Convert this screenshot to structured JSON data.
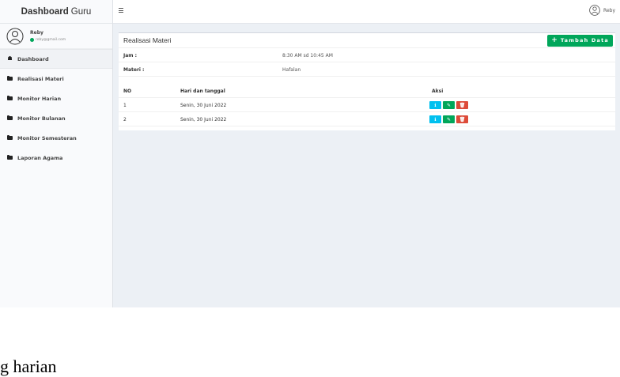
{
  "app": {
    "brand_bold": "Dashboard",
    "brand_light": "Guru"
  },
  "user": {
    "name": "Reby",
    "email": "reby@gmail.com",
    "topbar_name": "Reby"
  },
  "sidebar": {
    "items": [
      {
        "label": "Dashboard",
        "icon": "dashboard-icon",
        "active": true
      },
      {
        "label": "Realisasi Materi",
        "icon": "folder-icon"
      },
      {
        "label": "Monitor Harian",
        "icon": "folder-icon"
      },
      {
        "label": "Monitor Bulanan",
        "icon": "folder-icon"
      },
      {
        "label": "Monitor Semesteran",
        "icon": "folder-icon"
      },
      {
        "label": "Laporan Agama",
        "icon": "folder-icon"
      }
    ]
  },
  "box": {
    "title": "Realisasi Materi",
    "add_button": "Tambah Data",
    "jam_label": "Jam :",
    "jam_value": "8:30 AM sd 10:45 AM",
    "materi_label": "Materi :",
    "materi_value": "Hafalan"
  },
  "table": {
    "headers": [
      "NO",
      "Hari dan tanggal",
      "Aksi"
    ],
    "rows": [
      {
        "no": "1",
        "date": "Senin, 30 Juni 2022"
      },
      {
        "no": "2",
        "date": "Senin, 30 Juni 2022"
      }
    ],
    "action_icons": {
      "info": "ℹ",
      "edit": "✎",
      "delete": "🗑"
    }
  },
  "caption_fragment": "g harian",
  "colors": {
    "success": "#00a65a",
    "info": "#00c0ef",
    "danger": "#dd4b39",
    "background": "#ecf0f5"
  }
}
